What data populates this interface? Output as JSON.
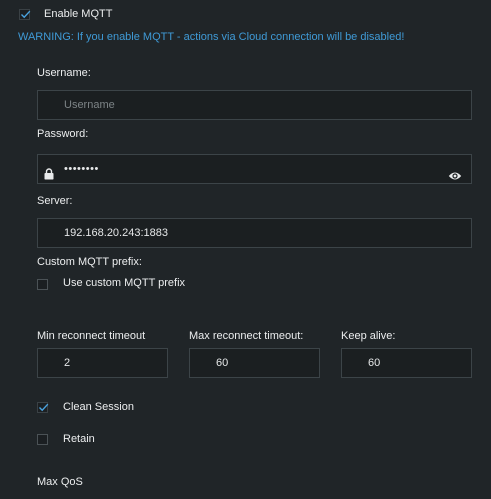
{
  "enable_mqtt": {
    "label": "Enable MQTT",
    "checked": true
  },
  "warning": "WARNING: If you enable MQTT - actions via Cloud connection will be disabled!",
  "username": {
    "label": "Username:",
    "placeholder": "Username",
    "value": ""
  },
  "password": {
    "label": "Password:",
    "value": "••••••••",
    "lock_icon": "lock-icon",
    "reveal_icon": "eye-icon"
  },
  "server": {
    "label": "Server:",
    "value": "192.168.20.243:1883"
  },
  "custom_prefix": {
    "label": "Custom MQTT prefix:",
    "checkbox_label": "Use custom MQTT prefix",
    "checked": false
  },
  "min_reconnect": {
    "label": "Min reconnect timeout",
    "value": "2"
  },
  "max_reconnect": {
    "label": "Max reconnect timeout:",
    "value": "60"
  },
  "keep_alive": {
    "label": "Keep alive:",
    "value": "60"
  },
  "clean_session": {
    "label": "Clean Session",
    "checked": true
  },
  "retain": {
    "label": "Retain",
    "checked": false
  },
  "max_qos": {
    "label": "Max QoS"
  },
  "colors": {
    "background": "#202528",
    "warning": "#3f9ad6",
    "check": "#4aa3df"
  }
}
